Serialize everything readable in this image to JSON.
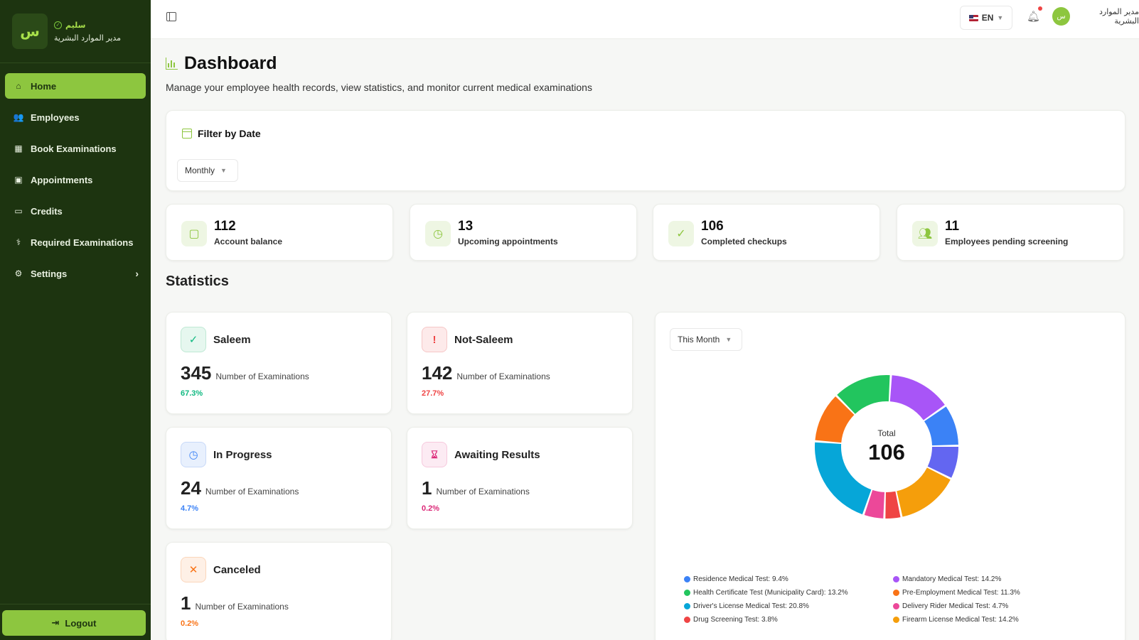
{
  "sidebar": {
    "brand": {
      "logo_letter": "س",
      "name": "سليم",
      "role": "مدير الموارد البشرية"
    },
    "items": [
      {
        "label": "Home",
        "icon": "home-icon",
        "active": true
      },
      {
        "label": "Employees",
        "icon": "users-icon"
      },
      {
        "label": "Book Examinations",
        "icon": "calendar-plus-icon"
      },
      {
        "label": "Appointments",
        "icon": "calendar-check-icon"
      },
      {
        "label": "Credits",
        "icon": "credit-card-icon"
      },
      {
        "label": "Required Examinations",
        "icon": "stethoscope-icon"
      },
      {
        "label": "Settings",
        "icon": "gear-icon"
      }
    ],
    "logout_label": "Logout"
  },
  "topbar": {
    "language": "EN",
    "user_name": "مدير الموارد البشرية",
    "avatar_letter": "س"
  },
  "page": {
    "title": "Dashboard",
    "subtitle": "Manage your employee health records, view statistics, and monitor current medical examinations"
  },
  "filter": {
    "title": "Filter by Date",
    "selected": "Monthly"
  },
  "stats": [
    {
      "value": "112",
      "label": "Account balance",
      "icon": "wallet-icon"
    },
    {
      "value": "13",
      "label": "Upcoming appointments",
      "icon": "clock-icon"
    },
    {
      "value": "106",
      "label": "Completed checkups",
      "icon": "check-circle-icon"
    },
    {
      "value": "11",
      "label": "Employees pending screening",
      "icon": "users-icon"
    }
  ],
  "statistics": {
    "title": "Statistics",
    "count_label": "Number of Examinations",
    "cards": [
      {
        "name": "Saleem",
        "count": "345",
        "percent": "67.3%",
        "color": "#10b981",
        "bg": "#e6f7ef",
        "icon": "check-circle-icon"
      },
      {
        "name": "Not-Saleem",
        "count": "142",
        "percent": "27.7%",
        "color": "#ef4444",
        "bg": "#fdeaea",
        "icon": "alert-circle-icon"
      },
      {
        "name": "In Progress",
        "count": "24",
        "percent": "4.7%",
        "color": "#3b82f6",
        "bg": "#e8f0fd",
        "icon": "clock-icon"
      },
      {
        "name": "Awaiting Results",
        "count": "1",
        "percent": "0.2%",
        "color": "#db2777",
        "bg": "#fcebf3",
        "icon": "hourglass-icon"
      },
      {
        "name": "Canceled",
        "count": "1",
        "percent": "0.2%",
        "color": "#f97316",
        "bg": "#fef0e6",
        "icon": "close-icon"
      }
    ]
  },
  "chart": {
    "period": "This Month",
    "total_label": "Total",
    "total": "106"
  },
  "chart_data": {
    "type": "pie",
    "categories": [
      "Residence Medical Test",
      "Mandatory Medical Test",
      "Health Certificate Test (Municipality Card)",
      "Pre-Employment Medical Test",
      "Driver's License Medical Test",
      "Delivery Rider Medical Test",
      "Drug Screening Test",
      "Firearm License Medical Test"
    ],
    "legend_labels": [
      "Residence Medical Test: 9.4%",
      "Mandatory Medical Test: 14.2%",
      "Health Certificate Test (Municipality Card): 13.2%",
      "Pre-Employment Medical Test: 11.3%",
      "Driver's License Medical Test: 20.8%",
      "Delivery Rider Medical Test: 4.7%",
      "Drug Screening Test: 3.8%",
      "Firearm License Medical Test: 14.2%"
    ],
    "values": [
      9.4,
      14.2,
      13.2,
      11.3,
      20.8,
      4.7,
      3.8,
      14.2
    ],
    "colors": [
      "#3b82f6",
      "#a855f7",
      "#22c55e",
      "#f97316",
      "#06a6d8",
      "#ec4899",
      "#ef4444",
      "#f59e0b"
    ],
    "ring_order": [
      1,
      0,
      8,
      7,
      6,
      5,
      4,
      3,
      2
    ],
    "ring_values": [
      14.2,
      9.4,
      7.5,
      14.2,
      3.8,
      4.7,
      20.8,
      11.3,
      13.2
    ],
    "ring_colors": [
      "#a855f7",
      "#3b82f6",
      "#6366f1",
      "#f59e0b",
      "#ef4444",
      "#ec4899",
      "#06a6d8",
      "#f97316",
      "#22c55e"
    ],
    "legend": "bottom"
  }
}
